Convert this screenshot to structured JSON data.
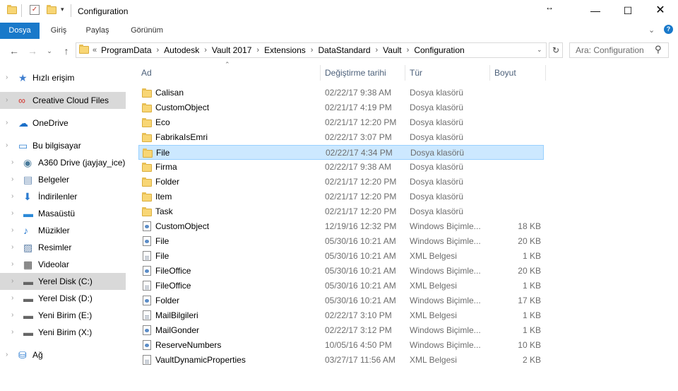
{
  "window": {
    "title": "Configuration"
  },
  "ribbon": {
    "tabs": [
      "Dosya",
      "Giriş",
      "Paylaş",
      "Görünüm"
    ]
  },
  "address": {
    "prefix": "«",
    "crumbs": [
      "ProgramData",
      "Autodesk",
      "Vault 2017",
      "Extensions",
      "DataStandard",
      "Vault",
      "Configuration"
    ]
  },
  "search": {
    "placeholder": "Ara: Configuration"
  },
  "nav": {
    "items": [
      {
        "label": "Hızlı erişim",
        "icon": "star-icon"
      },
      {
        "label": "Creative Cloud Files",
        "icon": "creative-cloud-icon"
      },
      {
        "label": "OneDrive",
        "icon": "cloud-icon"
      },
      {
        "label": "Bu bilgisayar",
        "icon": "computer-icon"
      },
      {
        "label": "A360 Drive (jayjay_ice)",
        "icon": "a360-drive-icon"
      },
      {
        "label": "Belgeler",
        "icon": "documents-icon"
      },
      {
        "label": "İndirilenler",
        "icon": "download-icon"
      },
      {
        "label": "Masaüstü",
        "icon": "desktop-icon"
      },
      {
        "label": "Müzikler",
        "icon": "music-icon"
      },
      {
        "label": "Resimler",
        "icon": "pictures-icon"
      },
      {
        "label": "Videolar",
        "icon": "video-icon"
      },
      {
        "label": "Yerel Disk (C:)",
        "icon": "drive-icon"
      },
      {
        "label": "Yerel Disk (D:)",
        "icon": "drive-icon"
      },
      {
        "label": "Yeni Birim (E:)",
        "icon": "drive-icon"
      },
      {
        "label": "Yeni Birim (X:)",
        "icon": "drive-icon"
      },
      {
        "label": "Ağ",
        "icon": "network-icon"
      }
    ]
  },
  "columns": {
    "name": "Ad",
    "date": "Değiştirme tarihi",
    "type": "Tür",
    "size": "Boyut"
  },
  "files": [
    {
      "name": "Calisan",
      "date": "02/22/17 9:38 AM",
      "type": "Dosya klasörü",
      "size": "",
      "kind": "folder"
    },
    {
      "name": "CustomObject",
      "date": "02/21/17 4:19 PM",
      "type": "Dosya klasörü",
      "size": "",
      "kind": "folder"
    },
    {
      "name": "Eco",
      "date": "02/21/17 12:20 PM",
      "type": "Dosya klasörü",
      "size": "",
      "kind": "folder"
    },
    {
      "name": "FabrikaIsEmri",
      "date": "02/22/17 3:07 PM",
      "type": "Dosya klasörü",
      "size": "",
      "kind": "folder"
    },
    {
      "name": "File",
      "date": "02/22/17 4:34 PM",
      "type": "Dosya klasörü",
      "size": "",
      "kind": "folder"
    },
    {
      "name": "Firma",
      "date": "02/22/17 9:38 AM",
      "type": "Dosya klasörü",
      "size": "",
      "kind": "folder"
    },
    {
      "name": "Folder",
      "date": "02/21/17 12:20 PM",
      "type": "Dosya klasörü",
      "size": "",
      "kind": "folder"
    },
    {
      "name": "Item",
      "date": "02/21/17 12:20 PM",
      "type": "Dosya klasörü",
      "size": "",
      "kind": "folder"
    },
    {
      "name": "Task",
      "date": "02/21/17 12:20 PM",
      "type": "Dosya klasörü",
      "size": "",
      "kind": "folder"
    },
    {
      "name": "CustomObject",
      "date": "12/19/16 12:32 PM",
      "type": "Windows Biçimle...",
      "size": "18 KB",
      "kind": "xaml"
    },
    {
      "name": "File",
      "date": "05/30/16 10:21 AM",
      "type": "Windows Biçimle...",
      "size": "20 KB",
      "kind": "xaml"
    },
    {
      "name": "File",
      "date": "05/30/16 10:21 AM",
      "type": "XML Belgesi",
      "size": "1 KB",
      "kind": "xml"
    },
    {
      "name": "FileOffice",
      "date": "05/30/16 10:21 AM",
      "type": "Windows Biçimle...",
      "size": "20 KB",
      "kind": "xaml"
    },
    {
      "name": "FileOffice",
      "date": "05/30/16 10:21 AM",
      "type": "XML Belgesi",
      "size": "1 KB",
      "kind": "xml"
    },
    {
      "name": "Folder",
      "date": "05/30/16 10:21 AM",
      "type": "Windows Biçimle...",
      "size": "17 KB",
      "kind": "xaml"
    },
    {
      "name": "MailBilgileri",
      "date": "02/22/17 3:10 PM",
      "type": "XML Belgesi",
      "size": "1 KB",
      "kind": "xml"
    },
    {
      "name": "MailGonder",
      "date": "02/22/17 3:12 PM",
      "type": "Windows Biçimle...",
      "size": "1 KB",
      "kind": "xaml"
    },
    {
      "name": "ReserveNumbers",
      "date": "10/05/16 4:50 PM",
      "type": "Windows Biçimle...",
      "size": "10 KB",
      "kind": "xaml"
    },
    {
      "name": "VaultDynamicProperties",
      "date": "03/27/17 11:56 AM",
      "type": "XML Belgesi",
      "size": "2 KB",
      "kind": "xml"
    }
  ],
  "selected_file": "File",
  "colors": {
    "accent": "#1979ca",
    "selection": "#cce8ff",
    "folder": "#f8d675"
  }
}
